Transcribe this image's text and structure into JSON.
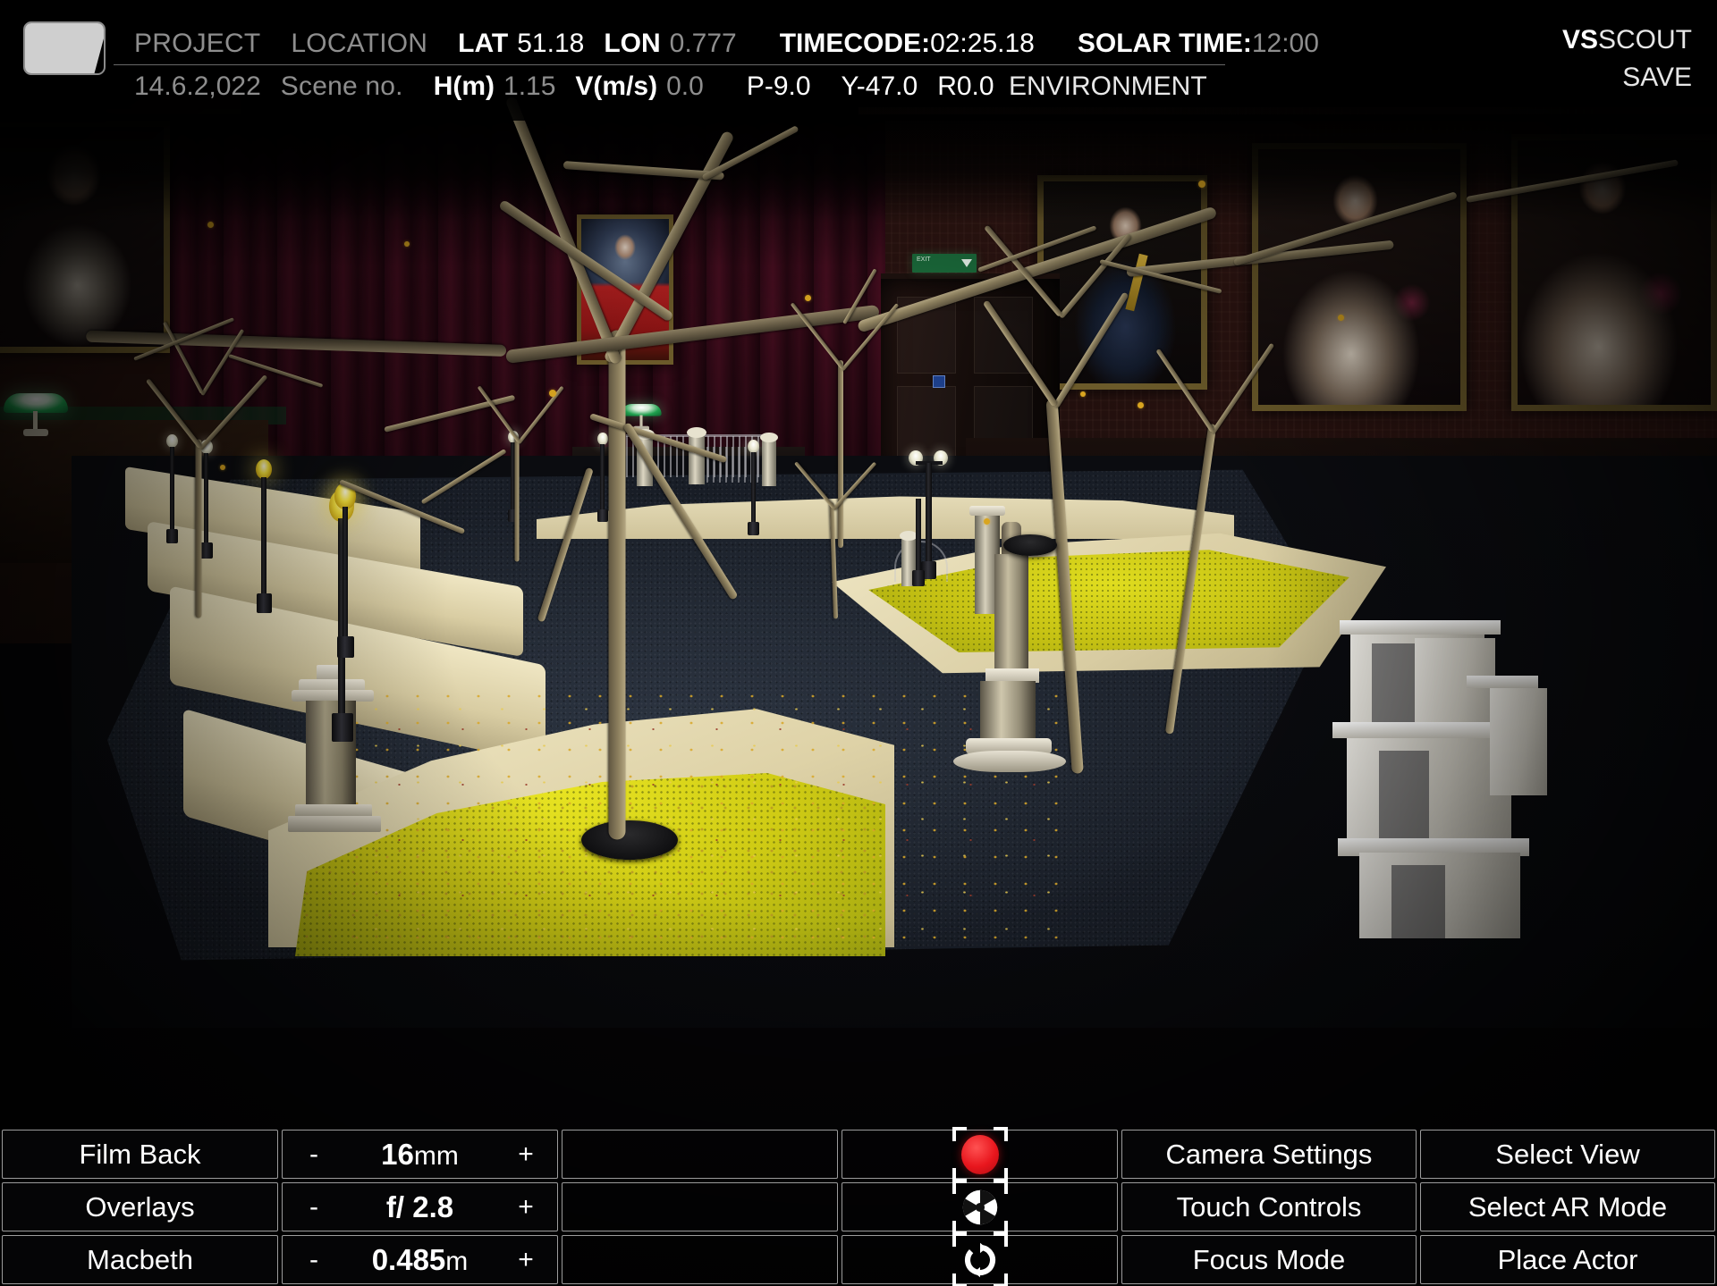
{
  "header": {
    "logo": "vs-logo-icon",
    "row1": {
      "project_label": "PROJECT",
      "location_label": "LOCATION",
      "lat_label": "LAT",
      "lat_value": "51.18",
      "lon_label": "LON",
      "lon_value": "0.777",
      "timecode_label": "TIMECODE:",
      "timecode_value": "02:25.18",
      "solar_time_label": "SOLAR TIME:",
      "solar_time_value": "12:00"
    },
    "row2": {
      "date_value": "14.6.2,022",
      "scene_label": "Scene no.",
      "height_label": "H(m)",
      "height_value": "1.15",
      "velocity_label": "V(m/s)",
      "velocity_value": "0.0",
      "pitch": "P-9.0",
      "yaw": "Y-47.0",
      "roll": "R0.0",
      "environment_label": "ENVIRONMENT"
    },
    "brand_bold": "VS",
    "brand_rest": "SCOUT",
    "brand_line2": "SAVE"
  },
  "toolbar": {
    "col1": [
      {
        "label": "Film Back",
        "name": "film-back-button"
      },
      {
        "label": "Overlays",
        "name": "overlays-button"
      },
      {
        "label": "Macbeth",
        "name": "macbeth-button"
      }
    ],
    "steppers": [
      {
        "minus": "-",
        "value": "16",
        "unit": "mm",
        "plus": "+",
        "name": "focal-length-stepper"
      },
      {
        "minus": "-",
        "value": "f/ 2.8",
        "unit": "",
        "plus": "+",
        "name": "aperture-stepper"
      },
      {
        "minus": "-",
        "value": "0.485",
        "unit": "m",
        "plus": "+",
        "name": "focus-distance-stepper"
      }
    ],
    "icons": [
      {
        "icon": "record-button-icon",
        "name": "record-button"
      },
      {
        "icon": "aperture-icon",
        "name": "aperture-button"
      },
      {
        "icon": "rotate-refresh-icon",
        "name": "reset-orientation-button"
      }
    ],
    "col5": [
      {
        "label": "Camera Settings",
        "name": "camera-settings-button"
      },
      {
        "label": "Touch Controls",
        "name": "touch-controls-button"
      },
      {
        "label": "Focus Mode",
        "name": "focus-mode-button"
      }
    ],
    "col6": [
      {
        "label": "Select View",
        "name": "select-view-button"
      },
      {
        "label": "Select AR Mode",
        "name": "select-ar-mode-button"
      },
      {
        "label": "Place Actor",
        "name": "place-actor-button"
      }
    ]
  },
  "scene": {
    "description": "AR virtual scouting viewfinder over a miniature park diorama set in a wood-panelled portrait hall",
    "exit_sign_text": "EXIT"
  },
  "colors": {
    "record_red": "#e8161d",
    "grass_yellow": "#d4d016",
    "kerb_cream": "#e7dcb4",
    "road_slate": "#242b36",
    "hud_dim": "#8e8e8e",
    "hud_bright": "#ffffff",
    "exit_green": "#1b6b3b"
  }
}
